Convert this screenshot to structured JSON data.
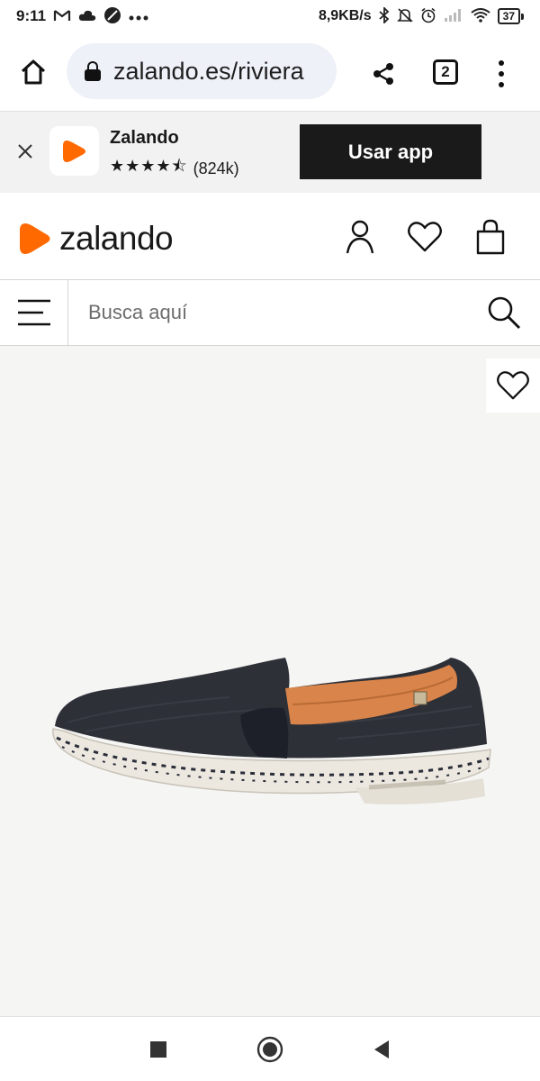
{
  "status_bar": {
    "time": "9:11",
    "net_speed": "8,9KB/s",
    "battery": "37",
    "left_icons": [
      "gmail-icon",
      "cloud-icon",
      "vpn-icon",
      "more-notifications-icon"
    ],
    "right_icons": [
      "bluetooth-icon",
      "mute-icon",
      "alarm-icon",
      "signal-icon",
      "wifi-icon"
    ]
  },
  "browser": {
    "url": "zalando.es/riviera",
    "tab_count": "2"
  },
  "app_banner": {
    "app_name": "Zalando",
    "rating_stars": "★★★★⯪",
    "rating_count": "(824k)",
    "button_label": "Usar app"
  },
  "header": {
    "logo_text": "zalando"
  },
  "search": {
    "placeholder": "Busca aquí"
  },
  "colors": {
    "brand_orange": "#ff6900",
    "banner_bg": "#f2f2f2",
    "product_bg": "#f5f5f4",
    "button_dark": "#1a1a1a"
  }
}
